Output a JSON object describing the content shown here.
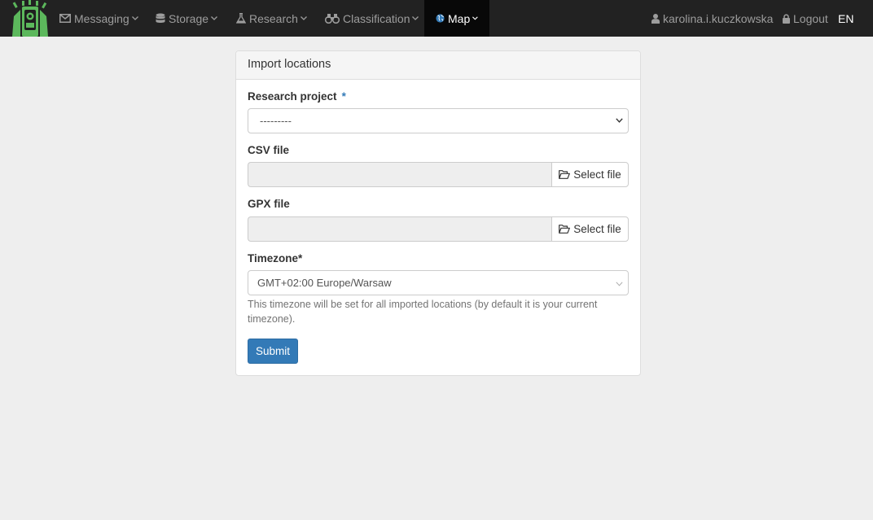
{
  "nav": {
    "messaging": "Messaging",
    "storage": "Storage",
    "research": "Research",
    "classification": "Classification",
    "map": "Map",
    "user": "karolina.i.kuczkowska",
    "logout": "Logout",
    "lang": "EN"
  },
  "panel": {
    "title": "Import locations",
    "research_project": {
      "label": "Research project",
      "required_mark": "*",
      "value": "---------"
    },
    "csv_file": {
      "label": "CSV file",
      "button": "Select file"
    },
    "gpx_file": {
      "label": "GPX file",
      "button": "Select file"
    },
    "timezone": {
      "label": "Timezone*",
      "value": "GMT+02:00 Europe/Warsaw",
      "help": "This timezone will be set for all imported locations (by default it is your current timezone)."
    },
    "submit": "Submit"
  },
  "colors": {
    "navbar": "#222222",
    "active_nav": "#080808",
    "primary": "#337ab7",
    "logo_green": "#5cb85c"
  }
}
